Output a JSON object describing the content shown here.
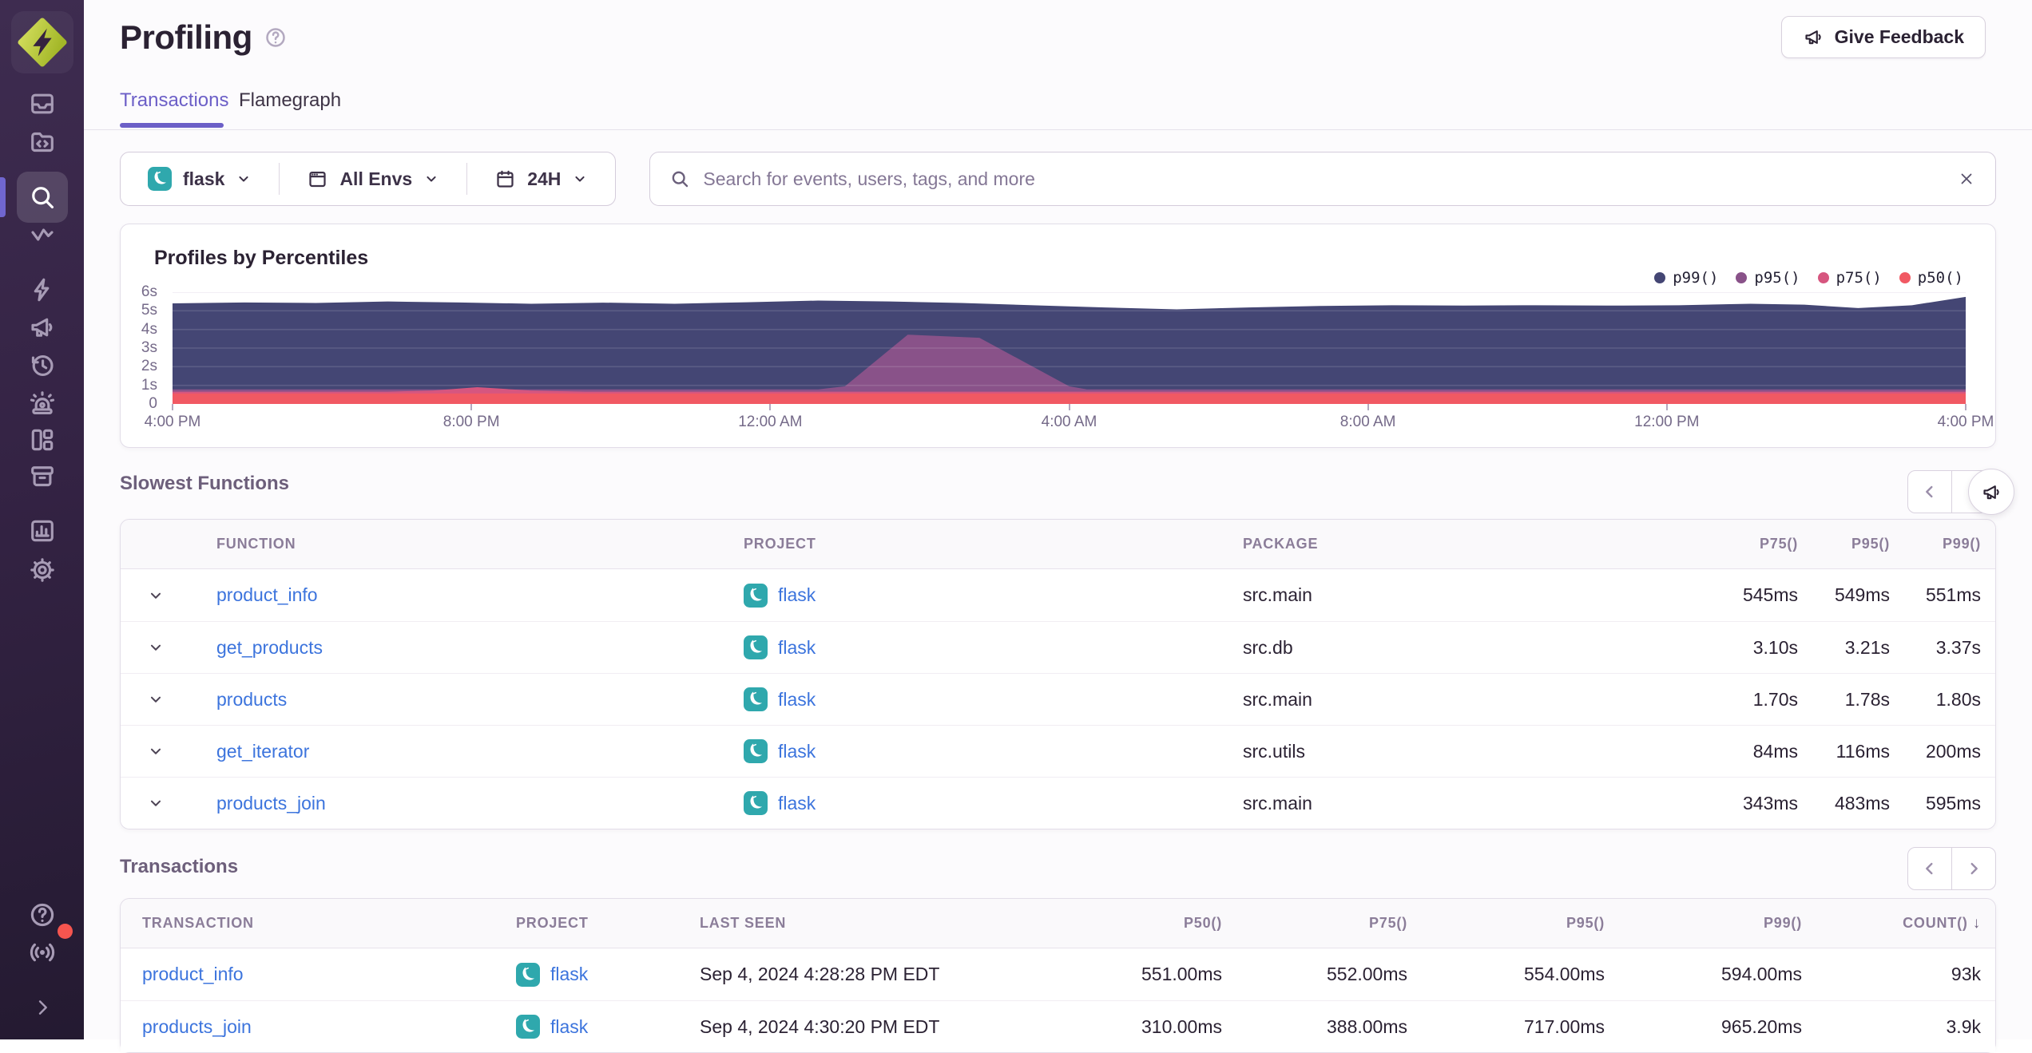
{
  "app": {
    "feedback_button": "Give Feedback"
  },
  "sidebar": {
    "icons": [
      "issues-inbox",
      "code-folder",
      "search",
      "stats-zigzag",
      "lightning",
      "megaphone",
      "clock-history",
      "alert-siren",
      "dashboards-layout",
      "archive-box",
      "bar-chart",
      "settings-gear",
      "help-circle",
      "broadcast",
      "expand-chevron"
    ],
    "active": "search",
    "notification_color": "#f6554f"
  },
  "header": {
    "title": "Profiling",
    "tabs": [
      {
        "label": "Transactions",
        "active": true
      },
      {
        "label": "Flamegraph",
        "active": false
      }
    ]
  },
  "filters": {
    "project": {
      "label": "flask"
    },
    "environment": {
      "label": "All Envs"
    },
    "period": {
      "label": "24H"
    },
    "search_placeholder": "Search for events, users, tags, and more"
  },
  "chart_data": {
    "type": "area",
    "title": "Profiles by Percentiles",
    "ylim": [
      0,
      6
    ],
    "yunit": "s",
    "y_ticks": [
      "6s",
      "5s",
      "4s",
      "3s",
      "2s",
      "1s",
      "0"
    ],
    "x_labels": [
      "4:00 PM",
      "8:00 PM",
      "12:00 AM",
      "4:00 AM",
      "8:00 AM",
      "12:00 PM",
      "4:00 PM"
    ],
    "grid": true,
    "legend_position": "top-right",
    "series": [
      {
        "name": "p99()",
        "color": "#444674",
        "points": [
          [
            0,
            5.4
          ],
          [
            0.04,
            5.45
          ],
          [
            0.08,
            5.42
          ],
          [
            0.12,
            5.5
          ],
          [
            0.16,
            5.45
          ],
          [
            0.2,
            5.38
          ],
          [
            0.24,
            5.44
          ],
          [
            0.28,
            5.38
          ],
          [
            0.32,
            5.46
          ],
          [
            0.36,
            5.55
          ],
          [
            0.4,
            5.5
          ],
          [
            0.44,
            5.42
          ],
          [
            0.48,
            5.3
          ],
          [
            0.52,
            5.18
          ],
          [
            0.56,
            5.08
          ],
          [
            0.6,
            5.18
          ],
          [
            0.64,
            5.26
          ],
          [
            0.68,
            5.3
          ],
          [
            0.72,
            5.28
          ],
          [
            0.76,
            5.3
          ],
          [
            0.8,
            5.28
          ],
          [
            0.84,
            5.3
          ],
          [
            0.88,
            5.38
          ],
          [
            0.91,
            5.33
          ],
          [
            0.94,
            5.15
          ],
          [
            0.97,
            5.3
          ],
          [
            1,
            5.75
          ]
        ]
      },
      {
        "name": "p95()",
        "color": "#895289",
        "points": [
          [
            0,
            0.78
          ],
          [
            0.36,
            0.78
          ],
          [
            0.375,
            0.95
          ],
          [
            0.41,
            3.72
          ],
          [
            0.45,
            3.55
          ],
          [
            0.5,
            0.95
          ],
          [
            0.51,
            0.78
          ],
          [
            1,
            0.78
          ]
        ]
      },
      {
        "name": "p75()",
        "color": "#d6567f",
        "points": [
          [
            0,
            0.66
          ],
          [
            0.12,
            0.66
          ],
          [
            0.145,
            0.72
          ],
          [
            0.17,
            0.9
          ],
          [
            0.2,
            0.72
          ],
          [
            0.23,
            0.66
          ],
          [
            1,
            0.66
          ]
        ]
      },
      {
        "name": "p50()",
        "color": "#f15963",
        "points": [
          [
            0,
            0.56
          ],
          [
            1,
            0.56
          ]
        ]
      }
    ]
  },
  "slowest_functions": {
    "heading": "Slowest Functions",
    "columns": [
      "FUNCTION",
      "PROJECT",
      "PACKAGE",
      "P75()",
      "P95()",
      "P99()"
    ],
    "rows": [
      {
        "function": "product_info",
        "project": "flask",
        "package": "src.main",
        "p75": "545ms",
        "p95": "549ms",
        "p99": "551ms"
      },
      {
        "function": "get_products",
        "project": "flask",
        "package": "src.db",
        "p75": "3.10s",
        "p95": "3.21s",
        "p99": "3.37s"
      },
      {
        "function": "products",
        "project": "flask",
        "package": "src.main",
        "p75": "1.70s",
        "p95": "1.78s",
        "p99": "1.80s"
      },
      {
        "function": "get_iterator",
        "project": "flask",
        "package": "src.utils",
        "p75": "84ms",
        "p95": "116ms",
        "p99": "200ms"
      },
      {
        "function": "products_join",
        "project": "flask",
        "package": "src.main",
        "p75": "343ms",
        "p95": "483ms",
        "p99": "595ms"
      }
    ]
  },
  "transactions": {
    "heading": "Transactions",
    "columns": [
      "TRANSACTION",
      "PROJECT",
      "LAST SEEN",
      "P50()",
      "P75()",
      "P95()",
      "P99()",
      "COUNT()"
    ],
    "sort": {
      "column": "COUNT()",
      "direction": "desc"
    },
    "rows": [
      {
        "transaction": "product_info",
        "project": "flask",
        "last_seen": "Sep 4, 2024 4:28:28 PM EDT",
        "p50": "551.00ms",
        "p75": "552.00ms",
        "p95": "554.00ms",
        "p99": "594.00ms",
        "count": "93k"
      },
      {
        "transaction": "products_join",
        "project": "flask",
        "last_seen": "Sep 4, 2024 4:30:20 PM EDT",
        "p50": "310.00ms",
        "p75": "388.00ms",
        "p95": "717.00ms",
        "p99": "965.20ms",
        "count": "3.9k"
      }
    ]
  }
}
